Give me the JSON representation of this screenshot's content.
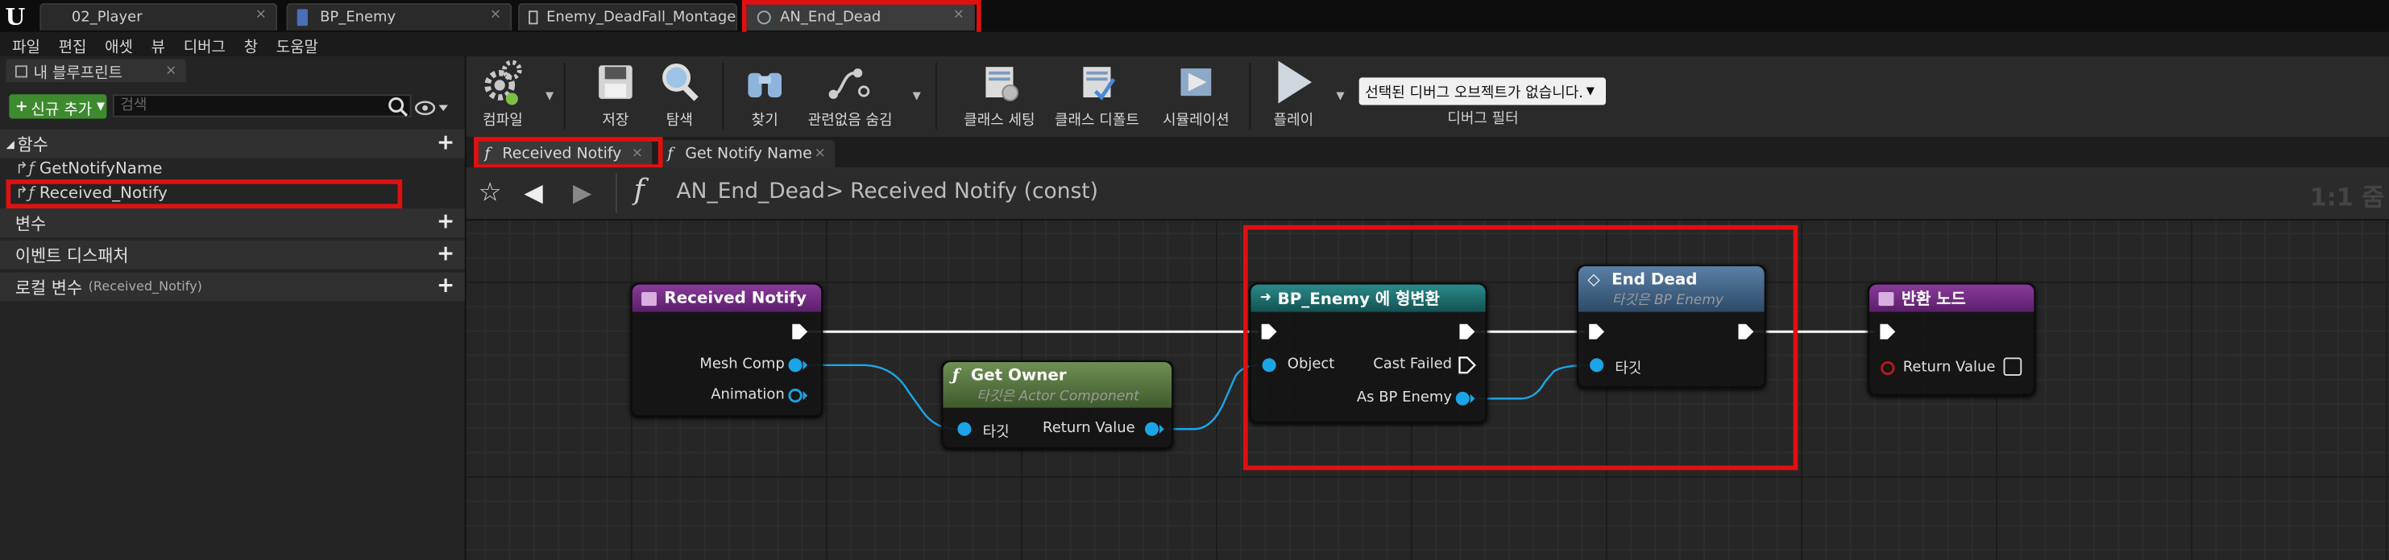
{
  "doc_tabs": [
    {
      "label": "02_Player",
      "icon": "unreal-logo-icon"
    },
    {
      "label": "BP_Enemy",
      "icon": "blueprint-icon"
    },
    {
      "label": "Enemy_DeadFall_Montage",
      "icon": "montage-icon"
    },
    {
      "label": "AN_End_Dead",
      "icon": "anim-notify-icon"
    }
  ],
  "menu": [
    "파일",
    "편집",
    "애셋",
    "뷰",
    "디버그",
    "창",
    "도움말"
  ],
  "left_panel": {
    "tab_label": "내 블루프린트",
    "add_button": "신규 추가",
    "search_placeholder": "검색",
    "functions_header": "함수",
    "functions": [
      "GetNotifyName",
      "Received_Notify"
    ],
    "variables_header": "변수",
    "dispatchers_header": "이벤트 디스패처",
    "local_vars_header": "로컬 변수",
    "local_vars_context": "(Received_Notify)"
  },
  "toolbar": {
    "compile": "컴파일",
    "save": "저장",
    "browse": "탐색",
    "find": "찾기",
    "hide_unrelated": "관련없음 숨김",
    "class_settings": "클래스 세팅",
    "class_defaults": "클래스 디폴트",
    "simulation": "시뮬레이션",
    "play": "플레이",
    "debug_select": "선택된 디버그 오브젝트가 없습니다.",
    "debug_filter": "디버그 필터"
  },
  "graph_tabs": [
    "Received Notify",
    "Get Notify Name"
  ],
  "breadcrumb": {
    "asset": "AN_End_Dead",
    "separator": ">",
    "function": "Received Notify (const)",
    "zoom": "1:1 줌"
  },
  "nodes": {
    "received_notify": {
      "title": "Received Notify",
      "pins": [
        "Mesh Comp",
        "Animation"
      ]
    },
    "get_owner": {
      "title": "Get Owner",
      "subtitle": "타깃은 Actor Component",
      "in_pin": "타깃",
      "out_pin": "Return Value"
    },
    "cast": {
      "title": "BP_Enemy 에 형변환",
      "in_pin": "Object",
      "out_fail": "Cast Failed",
      "out_as": "As BP Enemy"
    },
    "end_dead": {
      "title": "End Dead",
      "subtitle_prefix": "타깃은",
      "subtitle_class": "BP Enemy",
      "in_pin": "타깃"
    },
    "return_node": {
      "title": "반환 노드",
      "pin": "Return Value"
    }
  },
  "colors": {
    "highlight": "#e01010",
    "add_button": "#3d8b2e",
    "object_pin": "#1ca5e6",
    "exec_wire": "#ffffff",
    "function_node_head": "#7a2a8a",
    "pure_node_head": "#587b41",
    "cast_node_head": "#1c6b6b",
    "end_dead_head": "#3a5d80"
  }
}
